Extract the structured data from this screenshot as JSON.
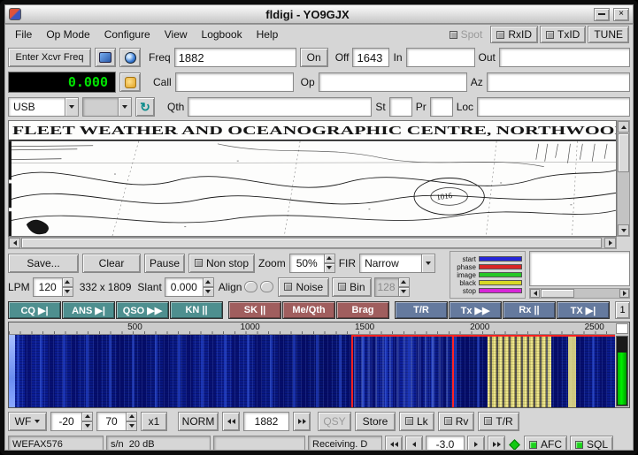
{
  "titlebar": {
    "title": "fldigi - YO9GJX"
  },
  "menu": {
    "items": [
      {
        "label": "File"
      },
      {
        "label": "Op Mode"
      },
      {
        "label": "Configure"
      },
      {
        "label": "View"
      },
      {
        "label": "Logbook"
      },
      {
        "label": "Help"
      }
    ],
    "spot": "Spot",
    "rxid": "RxID",
    "txid": "TxID",
    "tune": "TUNE"
  },
  "freq_row": {
    "xcvr_button": "Enter Xcvr Freq",
    "freq_label": "Freq",
    "freq_value": "1882",
    "on_button": "On",
    "off_label": "Off",
    "off_value": "1643",
    "in_label": "In",
    "in_value": "",
    "out_label": "Out",
    "out_value": ""
  },
  "rig_row": {
    "freq_display": "0.000",
    "call_label": "Call",
    "call_value": "",
    "op_label": "Op",
    "op_value": "",
    "az_label": "Az",
    "az_value": ""
  },
  "mode_row": {
    "mode_value": "USB",
    "qth_label": "Qth",
    "qth_value": "",
    "st_label": "St",
    "st_value": "",
    "pr_label": "Pr",
    "pr_value": "",
    "loc_label": "Loc",
    "loc_value": ""
  },
  "wefax_image": {
    "header": "FLEET WEATHER AND OCEANOGRAPHIC CENTRE, NORTHWOOD, ENGL",
    "annotation": "1016"
  },
  "wefax_ctrl": {
    "save": "Save...",
    "clear": "Clear",
    "pause": "Pause",
    "non_stop": "Non stop",
    "zoom_label": "Zoom",
    "zoom_value": "50%",
    "fir_label": "FIR",
    "fir_value": "Narrow",
    "legend": [
      {
        "label": "start",
        "color": "#2626d8"
      },
      {
        "label": "phase",
        "color": "#d82626"
      },
      {
        "label": "image",
        "color": "#26c826"
      },
      {
        "label": "black",
        "color": "#d8d826"
      },
      {
        "label": "stop",
        "color": "#d826d8"
      }
    ],
    "lpm_label": "LPM",
    "lpm_value": "120",
    "img_width": "332",
    "times_label": "x",
    "img_height": "1809",
    "slant_label": "Slant",
    "slant_value": "0.000",
    "align_label": "Align",
    "noise": "Noise",
    "bin": "Bin",
    "bin_value": "128"
  },
  "macros": {
    "items": [
      {
        "label": "CQ ▶|"
      },
      {
        "label": "ANS ▶|"
      },
      {
        "label": "QSO ▶▶"
      },
      {
        "label": "KN ||"
      },
      {
        "label": "SK ||"
      },
      {
        "label": "Me/Qth"
      },
      {
        "label": "Brag"
      },
      {
        "label": "T/R"
      },
      {
        "label": "Tx ▶▶"
      },
      {
        "label": "Rx ||"
      },
      {
        "label": "TX ▶|"
      }
    ],
    "set_number": "1"
  },
  "waterfall": {
    "ticks": [
      "500",
      "1000",
      "1500",
      "2000",
      "2500"
    ]
  },
  "wf_ctrl": {
    "wf_mode": "WF",
    "low": "-20",
    "range": "70",
    "zoom": "x1",
    "norm": "NORM",
    "carrier": "1882",
    "qsy": "QSY",
    "store": "Store",
    "lk": "Lk",
    "rv": "Rv",
    "tr": "T/R"
  },
  "status": {
    "mode": "WEFAX576",
    "snr": "s/n  20 dB",
    "status1": "",
    "message": "Receiving. D",
    "fine_tune": "-3.0",
    "afc": "AFC",
    "sql": "SQL"
  }
}
